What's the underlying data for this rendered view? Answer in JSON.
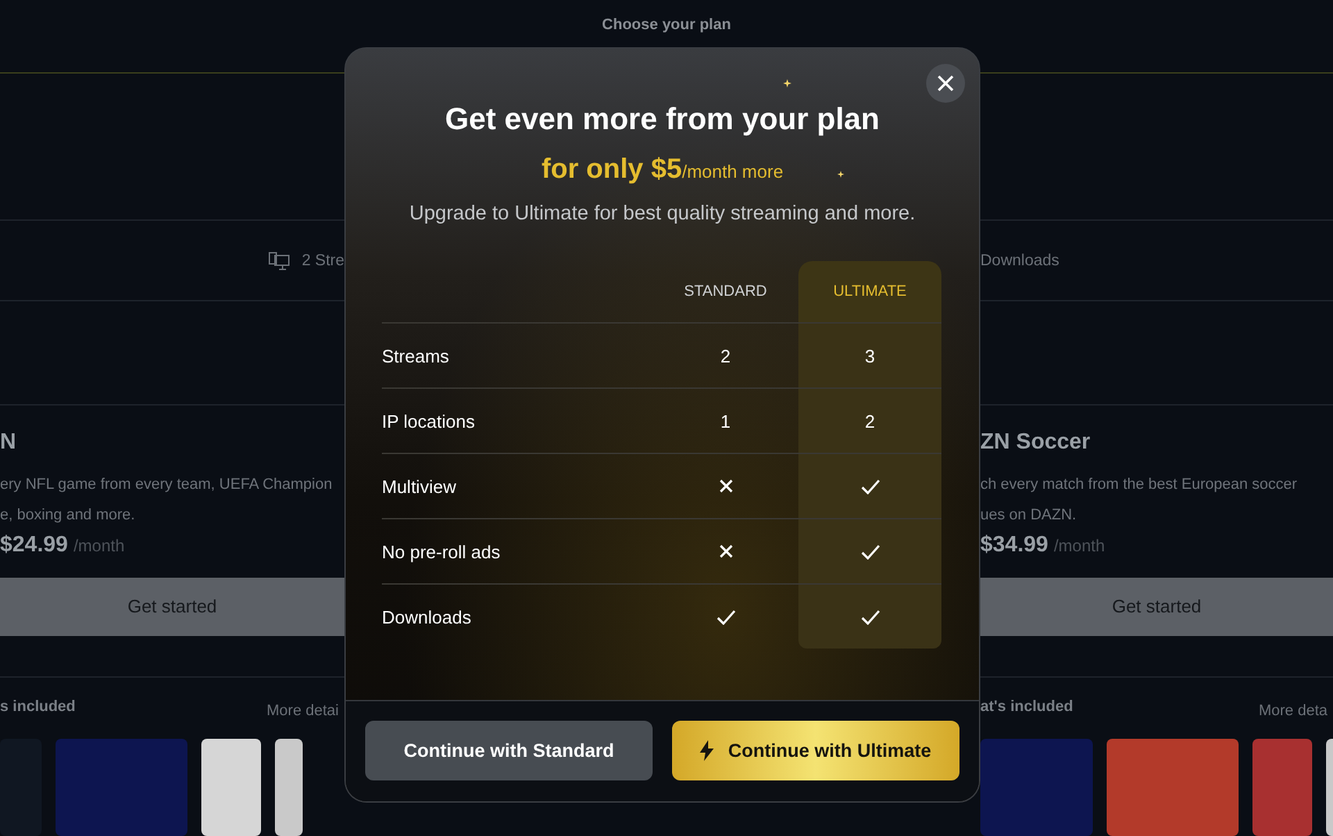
{
  "background": {
    "heading": "Choose your plan",
    "features": [
      {
        "text": "2 Stre",
        "kind": "left"
      },
      {
        "text": "Downloads",
        "kind": "right"
      }
    ],
    "plans": [
      {
        "title": "N",
        "description_lines": [
          "ery NFL game from every team, UEFA Champion",
          "e, boxing and more."
        ],
        "price": "$24.99",
        "period": "/month",
        "button": "Get started",
        "included": "s included",
        "more": "More detai"
      },
      {
        "title": "ZN Soccer",
        "description_lines": [
          "ch every match from the best European soccer",
          "ues on DAZN."
        ],
        "price": "$34.99",
        "period": "/month",
        "button": "Get started",
        "included": "at's included",
        "more": "More deta"
      }
    ]
  },
  "modal": {
    "title": "Get even more from your plan",
    "price": "for only $5",
    "price_suffix": "/month more",
    "subtitle": "Upgrade to Ultimate for best quality streaming and more.",
    "columns": [
      {
        "label": "STANDARD",
        "selected": false
      },
      {
        "label": "ULTIMATE",
        "selected": true
      }
    ],
    "rows": [
      {
        "label": "Streams",
        "cells": [
          {
            "kind": "text",
            "text": "2"
          },
          {
            "kind": "text",
            "text": "3"
          }
        ]
      },
      {
        "label": "IP locations",
        "cells": [
          {
            "kind": "text",
            "text": "1"
          },
          {
            "kind": "text",
            "text": "2"
          }
        ]
      },
      {
        "label": "Multiview",
        "cells": [
          {
            "kind": "cross"
          },
          {
            "kind": "check"
          }
        ]
      },
      {
        "label": "No pre-roll ads",
        "cells": [
          {
            "kind": "cross"
          },
          {
            "kind": "check"
          }
        ]
      },
      {
        "label": "Downloads",
        "cells": [
          {
            "kind": "check"
          },
          {
            "kind": "check"
          }
        ]
      }
    ],
    "buttons": [
      {
        "label": "Continue with Standard",
        "kind": "secondary"
      },
      {
        "label": "Continue with Ultimate",
        "kind": "primary"
      }
    ]
  }
}
